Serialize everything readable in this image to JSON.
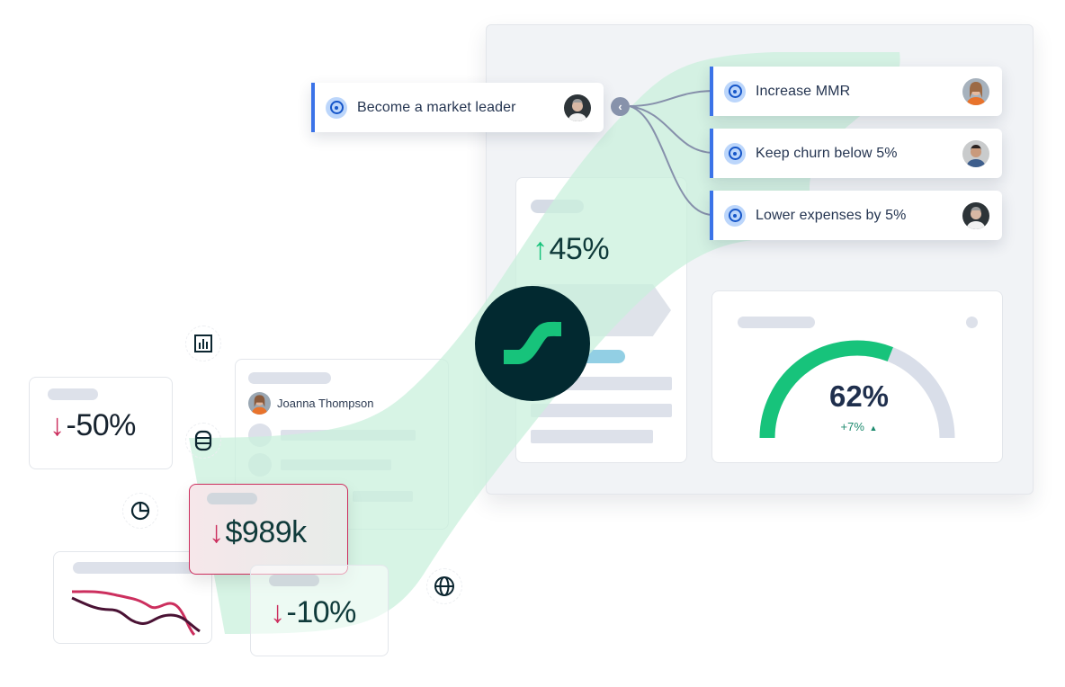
{
  "parent_goal": {
    "label": "Become a market leader",
    "icon": "target-icon",
    "owner_avatar": "avatar-man-gray-hair"
  },
  "collapse_control": {
    "icon": "chevron-left-icon",
    "glyph": "‹"
  },
  "child_goals": [
    {
      "label": "Increase MMR",
      "icon": "target-icon",
      "owner_avatar": "avatar-woman-orange"
    },
    {
      "label": "Keep churn below 5%",
      "icon": "target-icon",
      "owner_avatar": "avatar-man-blue-shirt"
    },
    {
      "label": "Lower expenses by 5%",
      "icon": "target-icon",
      "owner_avatar": "avatar-man-gray-hair"
    }
  ],
  "metrics": {
    "growth": {
      "value": "45%",
      "direction": "up",
      "arrow": "↑"
    },
    "decline_large": {
      "value": "-50%",
      "direction": "down",
      "arrow": "↓"
    },
    "revenue": {
      "value": "$989k",
      "direction": "down",
      "arrow": "↓"
    },
    "decline_small": {
      "value": "-10%",
      "direction": "down",
      "arrow": "↓"
    }
  },
  "gauge": {
    "value_label": "62%",
    "fraction": 0.62,
    "delta_label": "+7%",
    "delta_icon": "triangle-up-icon",
    "delta_glyph": "▲"
  },
  "person_card": {
    "name": "Joanna Thompson"
  },
  "sidebar_icons": [
    {
      "name": "bar-chart-icon"
    },
    {
      "name": "database-icon"
    },
    {
      "name": "pie-chart-icon"
    },
    {
      "name": "globe-icon"
    }
  ],
  "colors": {
    "accent_blue": "#3b73e8",
    "positive_green": "#17c37b",
    "negative_red": "#cc2f5e",
    "logo_bg": "#022930",
    "swoosh": "#c9f0dc",
    "gauge_track": "#d9dee9"
  }
}
